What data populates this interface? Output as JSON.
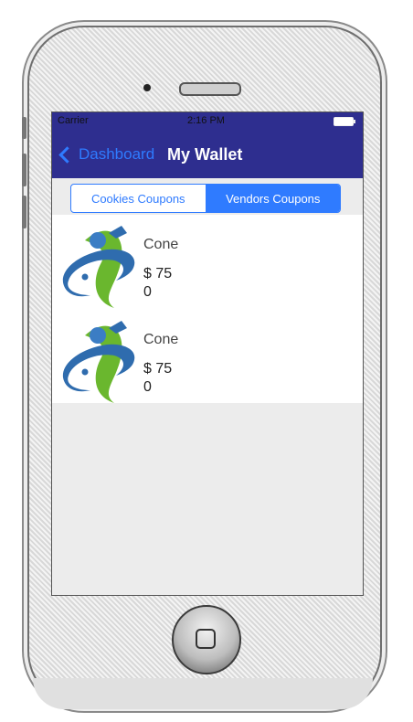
{
  "status": {
    "carrier": "Carrier",
    "time": "2:16 PM"
  },
  "nav": {
    "back_label": "Dashboard",
    "title": "My Wallet"
  },
  "segments": {
    "cookies": "Cookies Coupons",
    "vendors": "Vendors Coupons",
    "selected": "vendors"
  },
  "coupons": [
    {
      "name": "Cone",
      "price": "$ 75",
      "count": "0",
      "icon": "logo-icon"
    },
    {
      "name": "Cone",
      "price": "$ 75",
      "count": "0",
      "icon": "logo-icon"
    }
  ],
  "colors": {
    "nav_bg": "#2e2e8f",
    "accent": "#2f7bff"
  }
}
